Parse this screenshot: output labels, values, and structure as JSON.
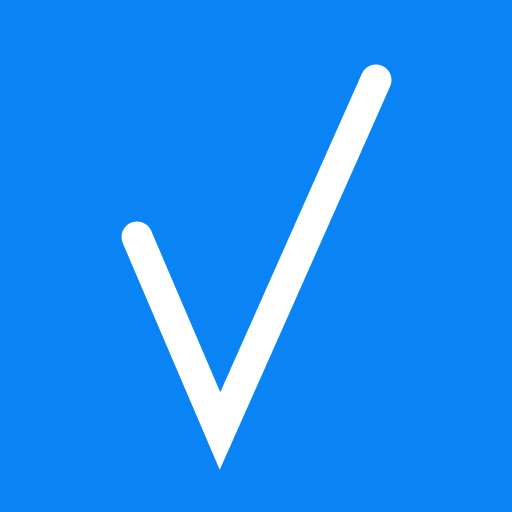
{
  "icon": {
    "name": "checkmark-icon",
    "background_color": "#0a84f5",
    "glyph_color": "#ffffff"
  }
}
